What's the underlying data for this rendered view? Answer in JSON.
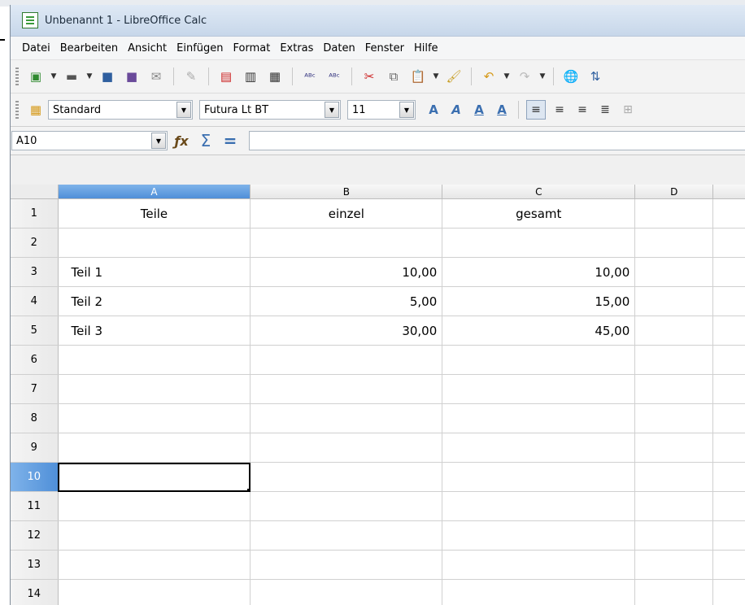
{
  "window": {
    "title": "Unbenannt 1 - LibreOffice Calc"
  },
  "menu": [
    "Datei",
    "Bearbeiten",
    "Ansicht",
    "Einfügen",
    "Format",
    "Extras",
    "Daten",
    "Fenster",
    "Hilfe"
  ],
  "format_bar": {
    "style": "Standard",
    "font": "Futura Lt BT",
    "size": "11"
  },
  "formula_bar": {
    "cell_ref": "A10",
    "content": ""
  },
  "sheet": {
    "columns": [
      "A",
      "B",
      "C",
      "D"
    ],
    "selected_column": "A",
    "selected_row": "10",
    "rows": [
      {
        "n": "1",
        "a": "Teile",
        "b": "einzel",
        "c": "gesamt",
        "d": ""
      },
      {
        "n": "2",
        "a": "",
        "b": "",
        "c": "",
        "d": ""
      },
      {
        "n": "3",
        "a": "Teil 1",
        "b": "10,00",
        "c": "10,00",
        "d": ""
      },
      {
        "n": "4",
        "a": "Teil 2",
        "b": "5,00",
        "c": "15,00",
        "d": ""
      },
      {
        "n": "5",
        "a": "Teil 3",
        "b": "30,00",
        "c": "45,00",
        "d": ""
      },
      {
        "n": "6",
        "a": "",
        "b": "",
        "c": "",
        "d": ""
      },
      {
        "n": "7",
        "a": "",
        "b": "",
        "c": "",
        "d": ""
      },
      {
        "n": "8",
        "a": "",
        "b": "",
        "c": "",
        "d": ""
      },
      {
        "n": "9",
        "a": "",
        "b": "",
        "c": "",
        "d": ""
      },
      {
        "n": "10",
        "a": "",
        "b": "",
        "c": "",
        "d": ""
      },
      {
        "n": "11",
        "a": "",
        "b": "",
        "c": "",
        "d": ""
      },
      {
        "n": "12",
        "a": "",
        "b": "",
        "c": "",
        "d": ""
      },
      {
        "n": "13",
        "a": "",
        "b": "",
        "c": "",
        "d": ""
      },
      {
        "n": "14",
        "a": "",
        "b": "",
        "c": "",
        "d": ""
      }
    ]
  }
}
